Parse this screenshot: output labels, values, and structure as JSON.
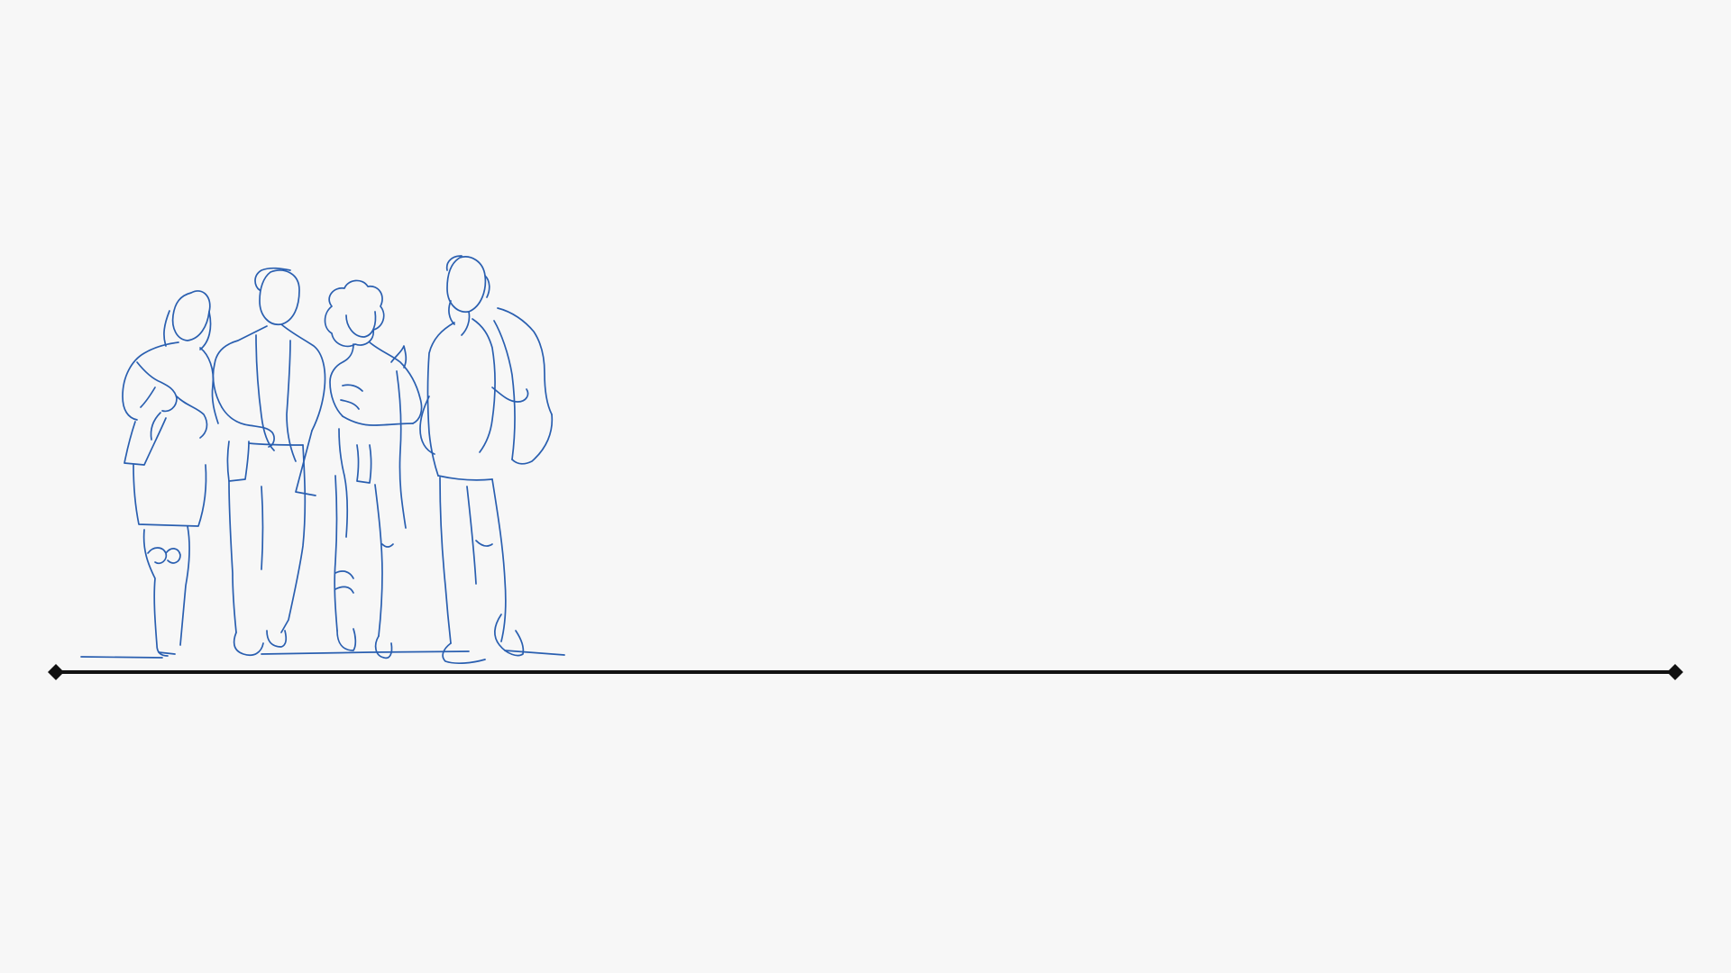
{
  "slide": {
    "background": "#f7f7f7",
    "illustration": {
      "subject": "group-of-four-people-line-art",
      "stroke_color": "#2a5fb0",
      "people": [
        {
          "name": "woman-left-holding-phone"
        },
        {
          "name": "man-with-jacket"
        },
        {
          "name": "woman-curly-hair-with-bag"
        },
        {
          "name": "man-with-backpack"
        }
      ]
    },
    "timeline": {
      "line_color": "#111111",
      "endpoint_marker": "diamond"
    }
  }
}
